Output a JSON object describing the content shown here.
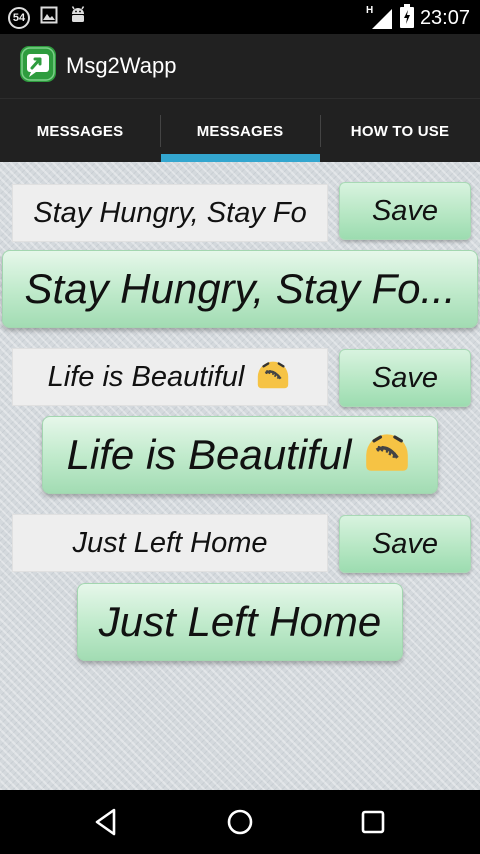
{
  "status_bar": {
    "notification_count": "54",
    "time": "23:07",
    "signal_type": "H",
    "icons": [
      "image-icon",
      "android-icon",
      "signal-icon",
      "battery-icon"
    ]
  },
  "app": {
    "title": "Msg2Wapp",
    "icon": "app-logo-icon",
    "brand_color": "#2e9c3e"
  },
  "tabs": [
    {
      "label": "MESSAGES",
      "selected": false
    },
    {
      "label": "MESSAGES",
      "selected": true
    },
    {
      "label": "HOW TO USE",
      "selected": false
    }
  ],
  "accent_color": "#33a6cf",
  "messages": [
    {
      "input_value": "Stay Hungry, Stay Fo",
      "save_label": "Save",
      "preview_text": "Stay Hungry, Stay Fo...",
      "emoji": ""
    },
    {
      "input_value": "Life is Beautiful",
      "save_label": "Save",
      "preview_text": "Life is Beautiful",
      "emoji": "zipper-mouth-emoji"
    },
    {
      "input_value": "Just Left Home",
      "save_label": "Save",
      "preview_text": "Just Left Home",
      "emoji": ""
    }
  ],
  "nav_bar": {
    "icons": [
      "back-icon",
      "home-icon",
      "recents-icon"
    ]
  }
}
